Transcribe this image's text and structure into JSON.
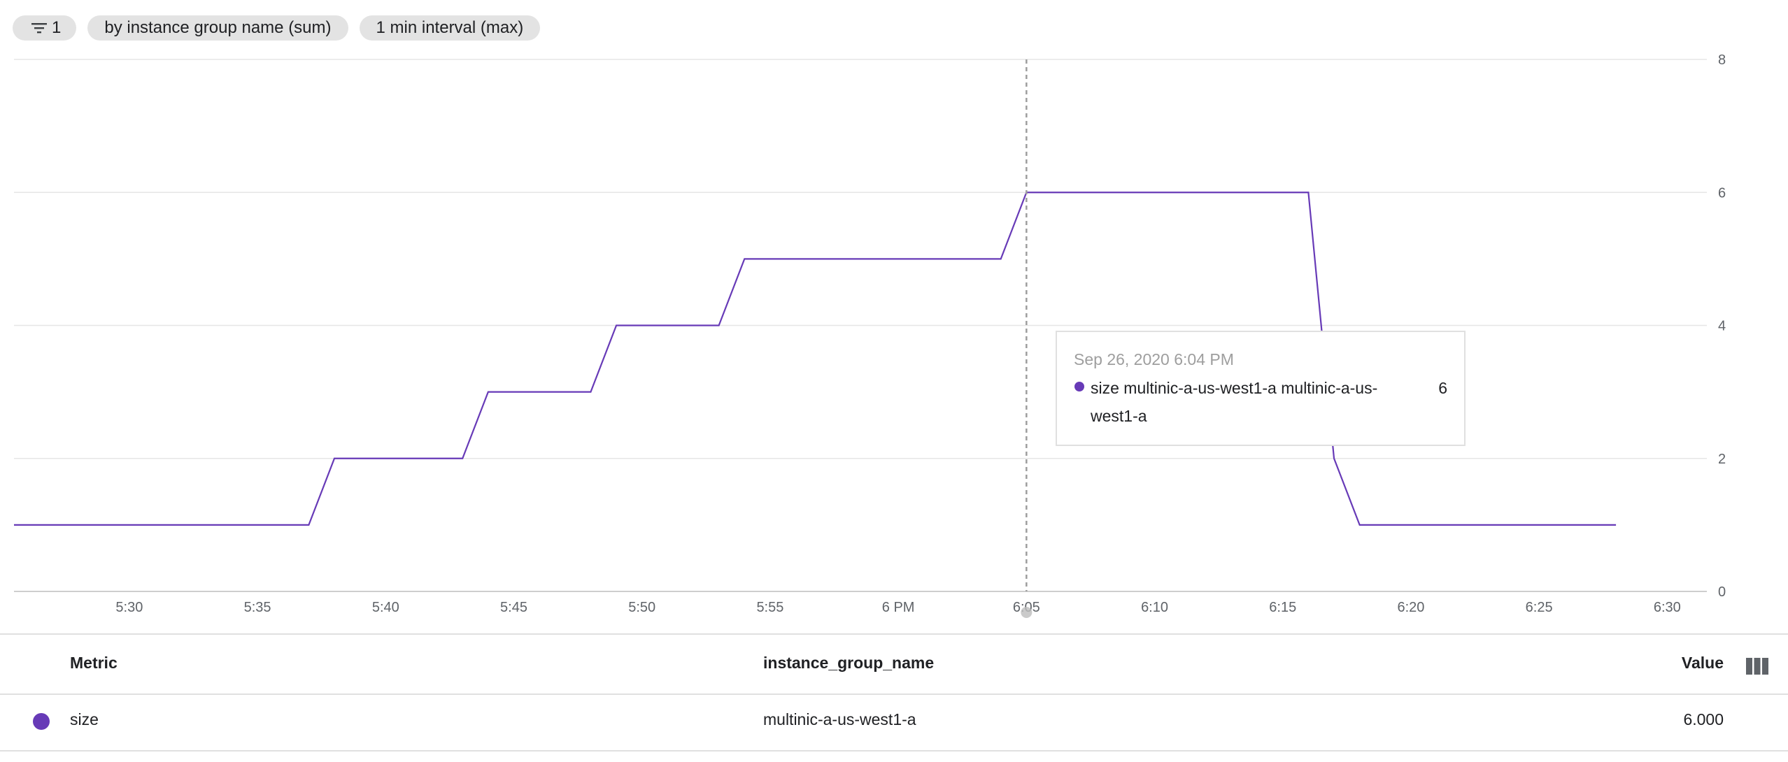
{
  "toolbar": {
    "filter_count": "1",
    "group_by_chip": "by instance group name (sum)",
    "interval_chip": "1 min interval (max)"
  },
  "chart_data": {
    "type": "line",
    "x_ticks": [
      "5:30",
      "5:35",
      "5:40",
      "5:45",
      "5:50",
      "5:55",
      "6 PM",
      "6:05",
      "6:10",
      "6:15",
      "6:20",
      "6:25",
      "6:30"
    ],
    "y_ticks": [
      "0",
      "2",
      "4",
      "6",
      "8"
    ],
    "ylim": [
      0,
      8
    ],
    "x_range": [
      "5:25:30 PM",
      "6:31:00 PM"
    ],
    "grid": true,
    "series": [
      {
        "name": "size multinic-a-us-west1-a multinic-a-us-west1-a",
        "color": "#673ab7",
        "points": [
          {
            "t": "5:25:30 PM",
            "v": 1
          },
          {
            "t": "5:37 PM",
            "v": 1
          },
          {
            "t": "5:38 PM",
            "v": 2
          },
          {
            "t": "5:43 PM",
            "v": 2
          },
          {
            "t": "5:44 PM",
            "v": 3
          },
          {
            "t": "5:48 PM",
            "v": 3
          },
          {
            "t": "5:49 PM",
            "v": 4
          },
          {
            "t": "5:53 PM",
            "v": 4
          },
          {
            "t": "5:54 PM",
            "v": 5
          },
          {
            "t": "6:04 PM",
            "v": 5
          },
          {
            "t": "6:05 PM",
            "v": 6
          },
          {
            "t": "6:16 PM",
            "v": 6
          },
          {
            "t": "6:17 PM",
            "v": 2
          },
          {
            "t": "6:18 PM",
            "v": 1
          },
          {
            "t": "6:28 PM",
            "v": 1
          }
        ]
      }
    ],
    "cursor_time": "6:05 PM"
  },
  "tooltip": {
    "date": "Sep 26, 2020 6:04 PM",
    "label": "size multinic-a-us-west1-a multinic-a-us-west1-a",
    "value": "6"
  },
  "table": {
    "headers": {
      "metric": "Metric",
      "group": "instance_group_name",
      "value": "Value"
    },
    "rows": [
      {
        "metric": "size",
        "group": "multinic-a-us-west1-a",
        "value": "6.000",
        "color": "#673ab7"
      }
    ]
  }
}
